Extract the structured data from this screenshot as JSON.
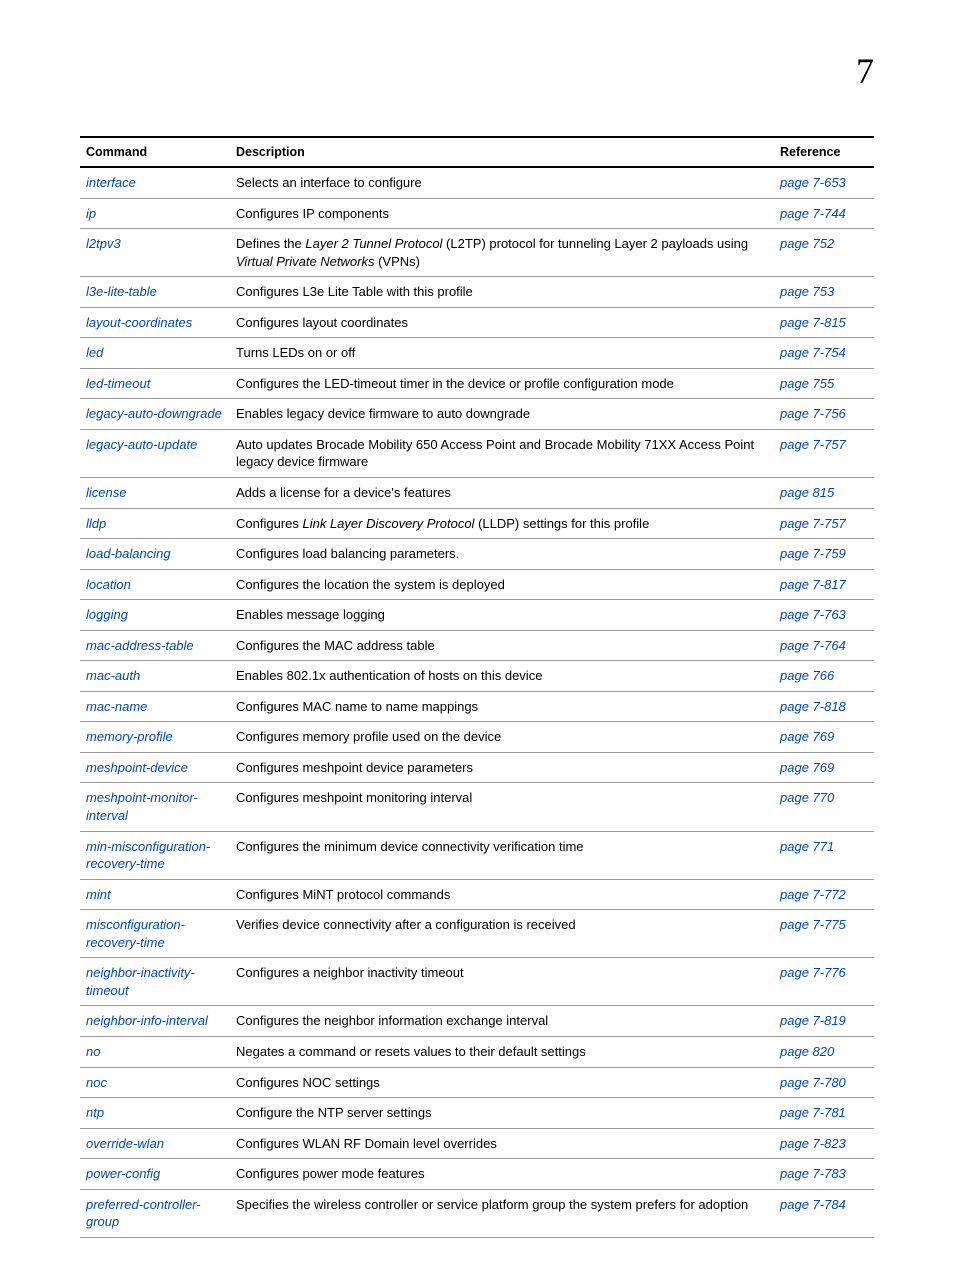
{
  "chapter_number": "7",
  "headers": {
    "command": "Command",
    "description": "Description",
    "reference": "Reference"
  },
  "rows": [
    {
      "command": "interface",
      "description": "Selects an interface to configure",
      "reference": "page 7-653"
    },
    {
      "command": "ip",
      "description": "Configures IP components",
      "reference": "page 7-744"
    },
    {
      "command": "l2tpv3",
      "desc_parts": [
        {
          "t": "Defines the "
        },
        {
          "t": "Layer 2 Tunnel Protocol",
          "i": true
        },
        {
          "t": " (L2TP) protocol for tunneling Layer 2 payloads using "
        },
        {
          "t": "Virtual Private Networks",
          "i": true
        },
        {
          "t": " (VPNs)"
        }
      ],
      "reference": "page 752"
    },
    {
      "command": "l3e-lite-table",
      "description": "Configures L3e Lite Table with this profile",
      "reference": "page 753"
    },
    {
      "command": "layout-coordinates",
      "description": "Configures layout coordinates",
      "reference": "page 7-815"
    },
    {
      "command": "led",
      "description": "Turns LEDs on or off",
      "reference": "page 7-754"
    },
    {
      "command": "led-timeout",
      "description": "Configures the LED-timeout timer in the device or profile configuration mode",
      "reference": "page 755"
    },
    {
      "command": "legacy-auto-downgrade",
      "description": "Enables legacy device firmware to auto downgrade",
      "reference": "page 7-756"
    },
    {
      "command": "legacy-auto-update",
      "description": "Auto updates Brocade Mobility 650 Access Point and Brocade Mobility 71XX Access Point legacy device firmware",
      "reference": "page 7-757"
    },
    {
      "command": "license",
      "description": "Adds a license for a device's features",
      "reference": "page 815"
    },
    {
      "command": "lldp",
      "desc_parts": [
        {
          "t": "Configures "
        },
        {
          "t": "Link Layer Discovery Protocol",
          "i": true
        },
        {
          "t": " (LLDP) settings for this profile"
        }
      ],
      "reference": "page 7-757"
    },
    {
      "command": "load-balancing",
      "description": "Configures load balancing parameters.",
      "reference": "page 7-759"
    },
    {
      "command": "location",
      "description": "Configures the location the system is deployed",
      "reference": "page 7-817"
    },
    {
      "command": "logging",
      "description": "Enables message logging",
      "reference": "page 7-763"
    },
    {
      "command": "mac-address-table",
      "description": "Configures the MAC address table",
      "reference": "page 7-764"
    },
    {
      "command": "mac-auth",
      "description": "Enables 802.1x authentication of hosts on this device",
      "reference": "page 766"
    },
    {
      "command": "mac-name",
      "description": "Configures MAC name to name mappings",
      "reference": "page 7-818"
    },
    {
      "command": "memory-profile",
      "description": "Configures memory profile used on the device",
      "reference": "page 769"
    },
    {
      "command": "meshpoint-device",
      "description": "Configures meshpoint device parameters",
      "reference": "page 769"
    },
    {
      "command": "meshpoint-monitor-interval",
      "description": "Configures meshpoint monitoring interval",
      "reference": "page 770"
    },
    {
      "command": "min-misconfiguration-recovery-time",
      "description": "Configures the minimum device connectivity verification time",
      "reference": "page 771"
    },
    {
      "command": "mint",
      "description": "Configures MiNT protocol commands",
      "reference": "page 7-772"
    },
    {
      "command": "misconfiguration-recovery-time",
      "description": "Verifies device connectivity after a configuration is received",
      "reference": "page 7-775"
    },
    {
      "command": "neighbor-inactivity-timeout",
      "description": "Configures a neighbor inactivity timeout",
      "reference": "page 7-776"
    },
    {
      "command": "neighbor-info-interval",
      "description": "Configures the neighbor information exchange interval",
      "reference": "page 7-819"
    },
    {
      "command": "no",
      "description": "Negates a command or resets values to their default settings",
      "reference": "page 820"
    },
    {
      "command": "noc",
      "description": "Configures NOC settings",
      "reference": "page 7-780"
    },
    {
      "command": "ntp",
      "description": "Configure the NTP server settings",
      "reference": "page 7-781"
    },
    {
      "command": "override-wlan",
      "description": "Configures WLAN RF Domain level overrides",
      "reference": "page 7-823"
    },
    {
      "command": "power-config",
      "description": "Configures power mode features",
      "reference": "page 7-783"
    },
    {
      "command": "preferred-controller-group",
      "description": "Specifies the wireless controller or service platform group the system prefers for adoption",
      "reference": "page 7-784"
    }
  ]
}
